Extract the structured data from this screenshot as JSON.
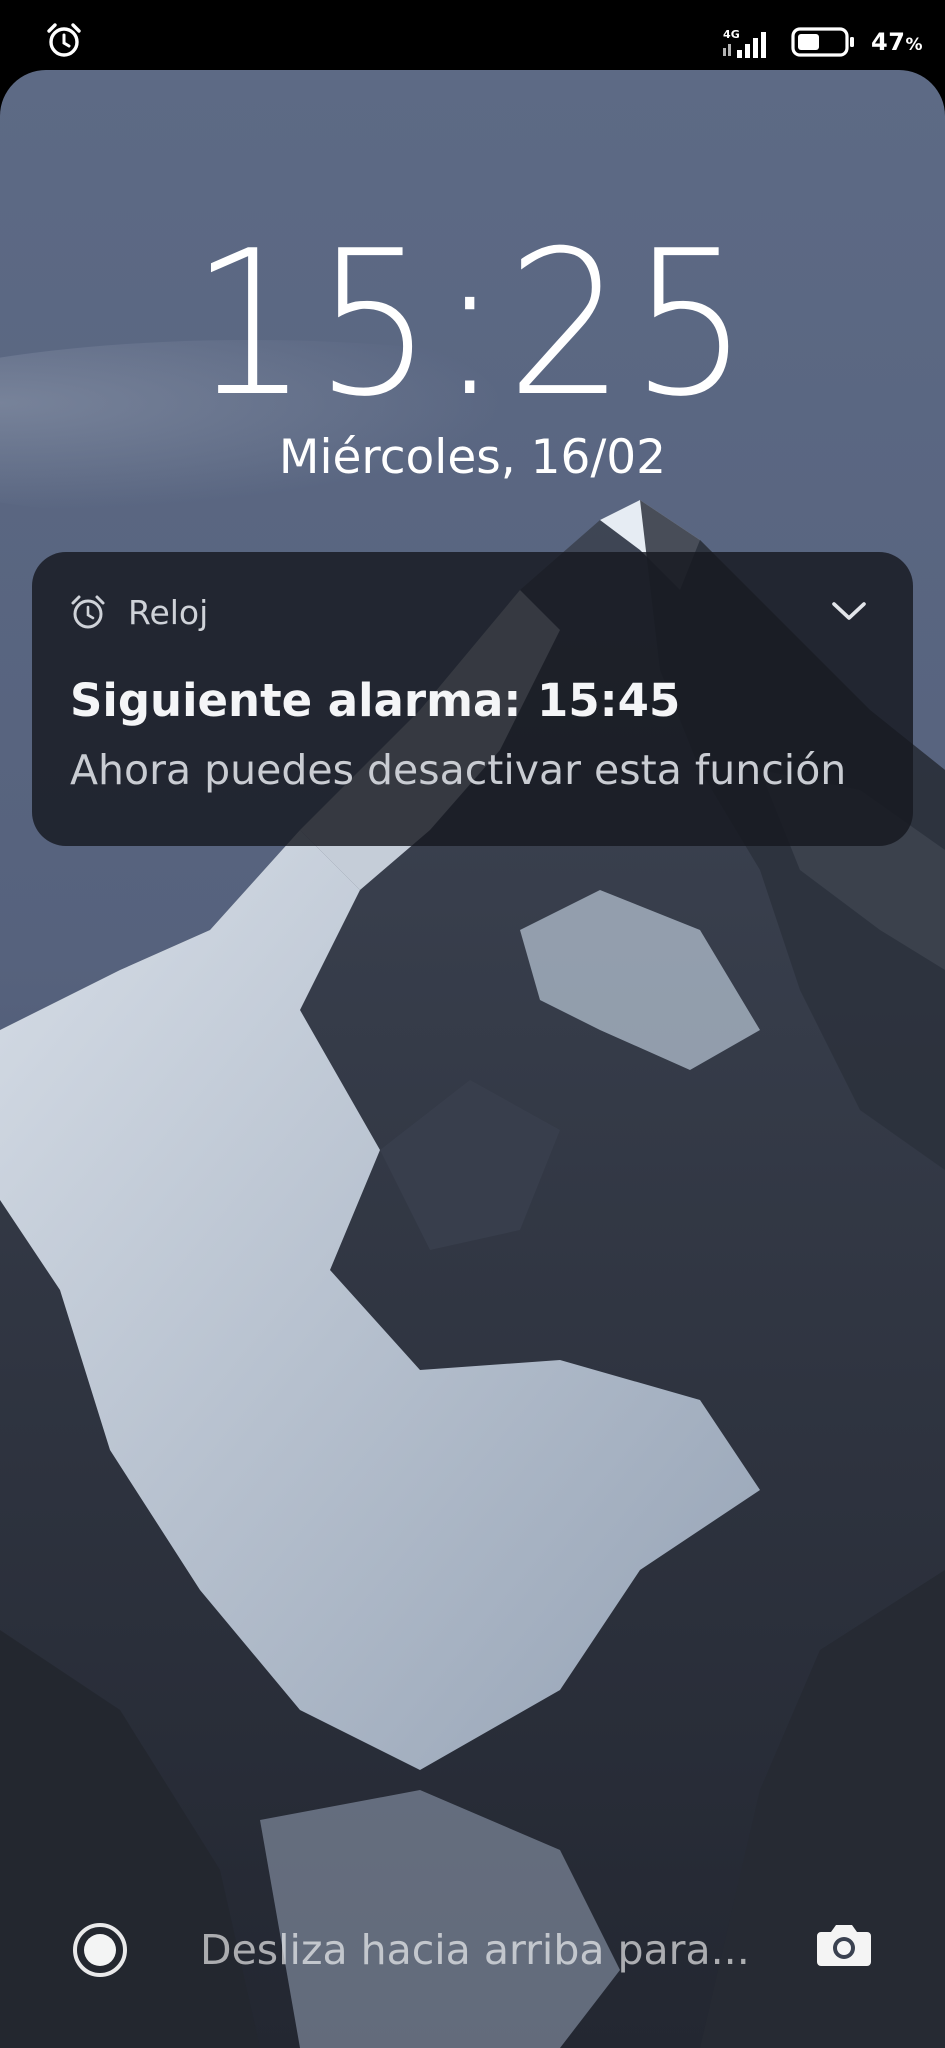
{
  "status_bar": {
    "left_icon": "alarm-clock-icon",
    "network": "4G",
    "signal_icon": "signal-bars-icon",
    "battery_icon": "battery-icon",
    "battery_level": 0.47,
    "battery_value": "47",
    "battery_unit": "%"
  },
  "lockscreen": {
    "time": "15:25",
    "date": "Miércoles, 16/02"
  },
  "notification": {
    "app_icon": "alarm-clock-icon",
    "app_name": "Reloj",
    "expand_icon": "chevron-down-icon",
    "title": "Siguiente alarma: 15:45",
    "text": "Ahora puedes desactivar esta función"
  },
  "bottom": {
    "left_shortcut_icon": "record-circle-icon",
    "hint": "Desliza hacia arriba para...",
    "camera_icon": "camera-icon"
  },
  "colors": {
    "sky_top": "#5e6b86",
    "sky_bottom": "#3c455c",
    "snow": "#c9d3e0",
    "rock": "#2b313d",
    "notification_bg": "#16181f"
  }
}
